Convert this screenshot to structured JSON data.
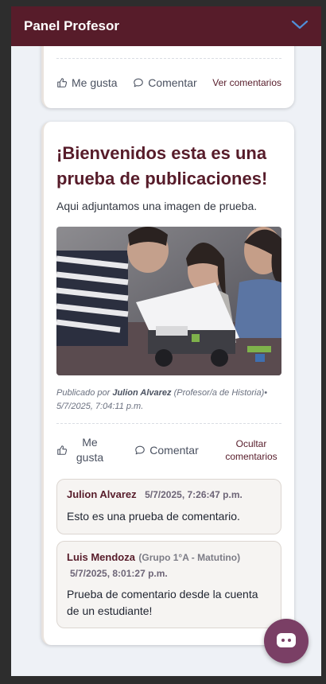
{
  "header": {
    "title": "Panel Profesor",
    "toggle_icon": "chevron-down-icon"
  },
  "previous_post": {
    "actions": {
      "like": "Me gusta",
      "comment": "Comentar",
      "view_comments": "Ver comentarios"
    }
  },
  "post": {
    "title": "¡Bienvenidos esta es una prueba de publicaciones!",
    "description": "Aqui adjuntamos una imagen de prueba.",
    "meta": {
      "prefix": "Publicado por",
      "author": "Julion Alvarez",
      "role": "(Profesor/a de Historia)",
      "date": "• 5/7/2025, 7:04:11 p.m."
    },
    "actions": {
      "like": "Me gusta",
      "comment": "Comentar",
      "hide_comments": "Ocultar comentarios"
    },
    "comments": [
      {
        "author": "Julion Alvarez",
        "subtitle": "",
        "date": "5/7/2025, 7:26:47 p.m.",
        "text": "Esto es una prueba de comentario."
      },
      {
        "author": "Luis Mendoza",
        "subtitle": "(Grupo 1°A - Matutino)",
        "date": "5/7/2025, 8:01:27 p.m.",
        "text": "Prueba de comentario desde la cuenta de un estudiante!"
      }
    ]
  },
  "colors": {
    "brand": "#571c2a",
    "fab": "#7a3f65",
    "chevron": "#4f8fd8"
  }
}
